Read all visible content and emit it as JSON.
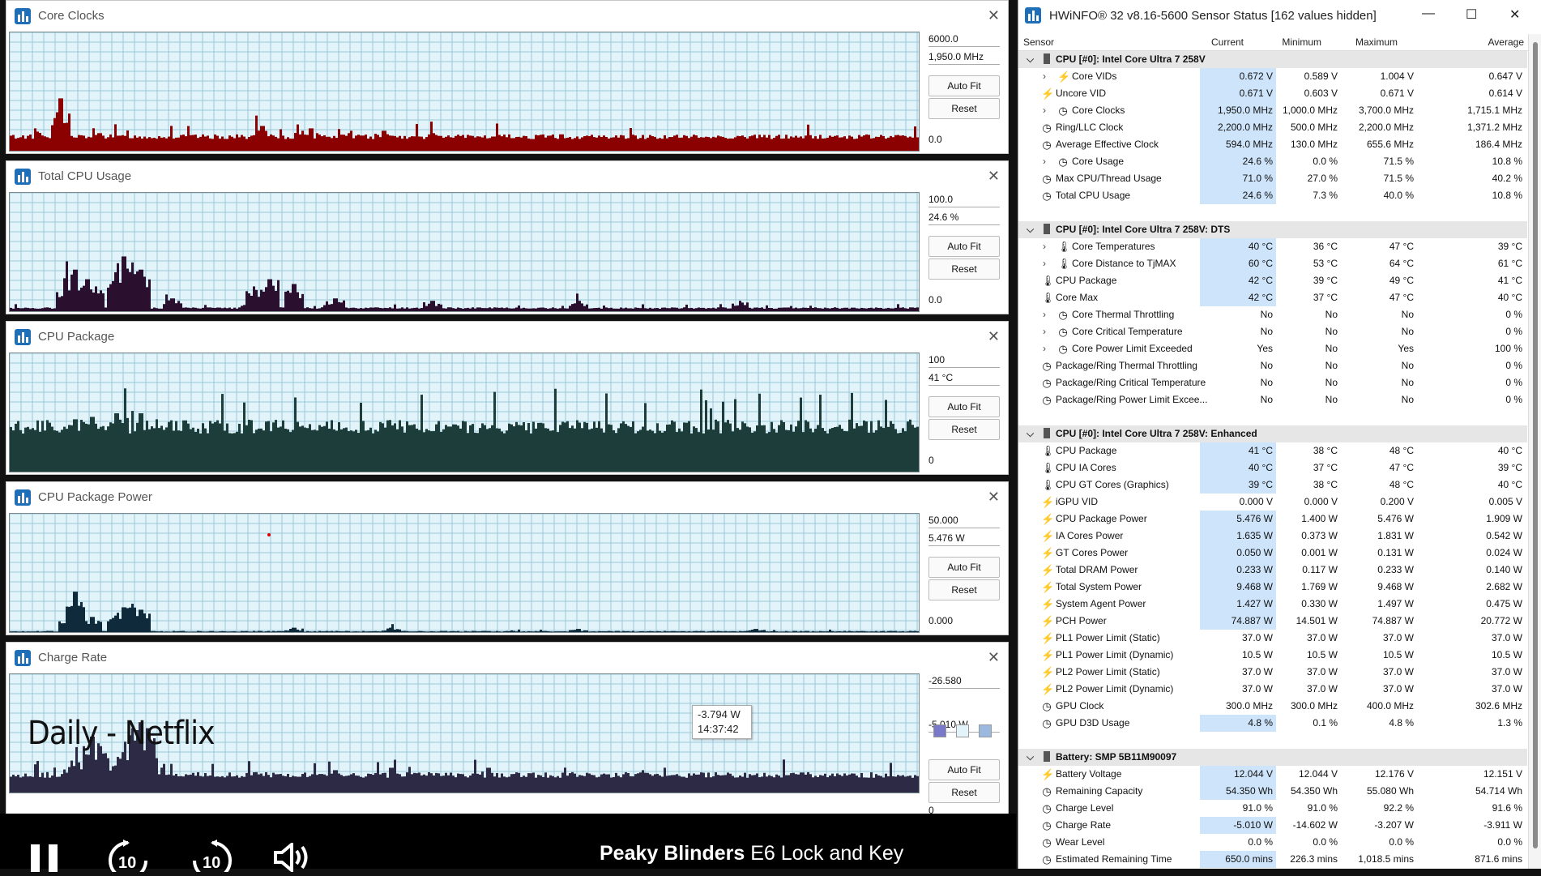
{
  "graphs": [
    {
      "title": "Core Clocks",
      "max": "6000.0",
      "current": "1,950.0 MHz",
      "min": "0.0",
      "autofit": "Auto Fit",
      "reset": "Reset",
      "color": "#8b0000",
      "base": 0.13,
      "spikes": [
        [
          62,
          0.45
        ],
        [
          30,
          0.2
        ],
        [
          110,
          0.16
        ],
        [
          310,
          0.22
        ],
        [
          360,
          0.18
        ],
        [
          370,
          0.2
        ],
        [
          420,
          0.18
        ],
        [
          460,
          0.18
        ],
        [
          520,
          0.16
        ],
        [
          600,
          0.15
        ],
        [
          680,
          0.15
        ]
      ]
    },
    {
      "title": "Total CPU Usage",
      "max": "100.0",
      "current": "24.6 %",
      "min": "0.0",
      "autofit": "Auto Fit",
      "reset": "Reset",
      "color": "#2a0f2e",
      "base": 0.04,
      "spikes": [
        [
          68,
          0.18
        ],
        [
          80,
          0.36
        ],
        [
          95,
          0.28
        ],
        [
          105,
          0.22
        ],
        [
          130,
          0.3
        ],
        [
          140,
          0.47
        ],
        [
          150,
          0.42
        ],
        [
          160,
          0.36
        ],
        [
          200,
          0.12
        ],
        [
          300,
          0.22
        ],
        [
          320,
          0.28
        ],
        [
          350,
          0.24
        ],
        [
          400,
          0.12
        ],
        [
          520,
          0.1
        ],
        [
          700,
          0.1
        ],
        [
          900,
          0.1
        ]
      ]
    },
    {
      "title": "CPU Package",
      "max": "100",
      "current": "41 °C",
      "min": "0",
      "autofit": "Auto Fit",
      "reset": "Reset",
      "color": "#1d3d3a",
      "base": 0.39,
      "spikes": [
        [
          80,
          0.45
        ],
        [
          100,
          0.47
        ],
        [
          130,
          0.5
        ],
        [
          150,
          0.52
        ],
        [
          160,
          0.5
        ],
        [
          180,
          0.45
        ]
      ]
    },
    {
      "title": "CPU Package Power",
      "max": "50.000",
      "current": "5.476 W",
      "min": "0.000",
      "autofit": "Auto Fit",
      "reset": "Reset",
      "color": "#0f2a3a",
      "base": 0.02,
      "spikes": [
        [
          70,
          0.12
        ],
        [
          80,
          0.35
        ],
        [
          90,
          0.12
        ],
        [
          100,
          0.14
        ],
        [
          130,
          0.15
        ],
        [
          140,
          0.22
        ],
        [
          150,
          0.25
        ],
        [
          160,
          0.2
        ],
        [
          350,
          0.05
        ],
        [
          470,
          0.05
        ],
        [
          700,
          0.04
        ],
        [
          920,
          0.04
        ]
      ]
    },
    {
      "title": "Charge Rate",
      "max": "-26.580",
      "current": "-5.010 W",
      "min": "0",
      "autofit": "Auto Fit",
      "reset": "Reset",
      "color": "#2c2a45",
      "base": 0.16,
      "spikes": [
        [
          75,
          0.28
        ],
        [
          90,
          0.4
        ],
        [
          100,
          0.48
        ],
        [
          110,
          0.4
        ],
        [
          120,
          0.3
        ],
        [
          140,
          0.35
        ],
        [
          150,
          0.55
        ],
        [
          160,
          0.6
        ],
        [
          170,
          0.55
        ],
        [
          180,
          0.3
        ],
        [
          400,
          0.2
        ],
        [
          470,
          0.22
        ],
        [
          590,
          0.22
        ],
        [
          780,
          0.2
        ]
      ],
      "overlay": "Daily - Netflix",
      "tooltip_value": "-3.794 W",
      "tooltip_time": "14:37:42"
    }
  ],
  "player": {
    "title_show": "Peaky Blinders",
    "title_ep": "E6  Lock and Key",
    "skip_back": "10",
    "skip_fwd": "10"
  },
  "sensor": {
    "title": "HWiNFO® 32 v8.16-5600 Sensor Status [162 values hidden]",
    "columns": {
      "sensor": "Sensor",
      "current": "Current",
      "minimum": "Minimum",
      "maximum": "Maximum",
      "average": "Average"
    },
    "rows": [
      {
        "t": "group",
        "label": "CPU [#0]: Intel Core Ultra 7 258V"
      },
      {
        "t": "row",
        "icon": "bolt",
        "exp": true,
        "label": "Core VIDs",
        "cur": "0.672 V",
        "min": "0.589 V",
        "max": "1.004 V",
        "avg": "0.647 V",
        "hl": true
      },
      {
        "t": "row",
        "icon": "bolt",
        "label": "Uncore VID",
        "cur": "0.671 V",
        "min": "0.603 V",
        "max": "0.671 V",
        "avg": "0.614 V",
        "hl": true
      },
      {
        "t": "row",
        "icon": "clock",
        "exp": true,
        "label": "Core Clocks",
        "cur": "1,950.0 MHz",
        "min": "1,000.0 MHz",
        "max": "3,700.0 MHz",
        "avg": "1,715.1 MHz",
        "hl": true
      },
      {
        "t": "row",
        "icon": "clock",
        "label": "Ring/LLC Clock",
        "cur": "2,200.0 MHz",
        "min": "500.0 MHz",
        "max": "2,200.0 MHz",
        "avg": "1,371.2 MHz",
        "hl": true
      },
      {
        "t": "row",
        "icon": "clock",
        "label": "Average Effective Clock",
        "cur": "594.0 MHz",
        "min": "130.0 MHz",
        "max": "655.6 MHz",
        "avg": "186.4 MHz",
        "hl": true
      },
      {
        "t": "row",
        "icon": "clock",
        "exp": true,
        "label": "Core Usage",
        "cur": "24.6 %",
        "min": "0.0 %",
        "max": "71.5 %",
        "avg": "10.8 %",
        "hl": true
      },
      {
        "t": "row",
        "icon": "clock",
        "label": "Max CPU/Thread Usage",
        "cur": "71.0 %",
        "min": "27.0 %",
        "max": "71.5 %",
        "avg": "40.2 %",
        "hl": true
      },
      {
        "t": "row",
        "icon": "clock",
        "label": "Total CPU Usage",
        "cur": "24.6 %",
        "min": "7.3 %",
        "max": "40.0 %",
        "avg": "10.8 %",
        "hl": true
      },
      {
        "t": "blank"
      },
      {
        "t": "group",
        "label": "CPU [#0]: Intel Core Ultra 7 258V: DTS"
      },
      {
        "t": "row",
        "icon": "therm",
        "exp": true,
        "label": "Core Temperatures",
        "cur": "40 °C",
        "min": "36 °C",
        "max": "47 °C",
        "avg": "39 °C",
        "hl": true
      },
      {
        "t": "row",
        "icon": "therm",
        "exp": true,
        "label": "Core Distance to TjMAX",
        "cur": "60 °C",
        "min": "53 °C",
        "max": "64 °C",
        "avg": "61 °C",
        "hl": true
      },
      {
        "t": "row",
        "icon": "therm",
        "label": "CPU Package",
        "cur": "42 °C",
        "min": "39 °C",
        "max": "49 °C",
        "avg": "41 °C",
        "hl": true
      },
      {
        "t": "row",
        "icon": "therm",
        "label": "Core Max",
        "cur": "42 °C",
        "min": "37 °C",
        "max": "47 °C",
        "avg": "40 °C",
        "hl": true
      },
      {
        "t": "row",
        "icon": "clock",
        "exp": true,
        "label": "Core Thermal Throttling",
        "cur": "No",
        "min": "No",
        "max": "No",
        "avg": "0 %"
      },
      {
        "t": "row",
        "icon": "clock",
        "exp": true,
        "label": "Core Critical Temperature",
        "cur": "No",
        "min": "No",
        "max": "No",
        "avg": "0 %"
      },
      {
        "t": "row",
        "icon": "clock",
        "exp": true,
        "label": "Core Power Limit Exceeded",
        "cur": "Yes",
        "min": "No",
        "max": "Yes",
        "avg": "100 %"
      },
      {
        "t": "row",
        "icon": "clock",
        "label": "Package/Ring Thermal Throttling",
        "cur": "No",
        "min": "No",
        "max": "No",
        "avg": "0 %"
      },
      {
        "t": "row",
        "icon": "clock",
        "label": "Package/Ring Critical Temperature",
        "cur": "No",
        "min": "No",
        "max": "No",
        "avg": "0 %"
      },
      {
        "t": "row",
        "icon": "clock",
        "label": "Package/Ring Power Limit Excee...",
        "cur": "No",
        "min": "No",
        "max": "No",
        "avg": "0 %"
      },
      {
        "t": "blank"
      },
      {
        "t": "group",
        "label": "CPU [#0]: Intel Core Ultra 7 258V: Enhanced"
      },
      {
        "t": "row",
        "icon": "therm",
        "label": "CPU Package",
        "cur": "41 °C",
        "min": "38 °C",
        "max": "48 °C",
        "avg": "40 °C",
        "hl": true
      },
      {
        "t": "row",
        "icon": "therm",
        "label": "CPU IA Cores",
        "cur": "40 °C",
        "min": "37 °C",
        "max": "47 °C",
        "avg": "39 °C",
        "hl": true
      },
      {
        "t": "row",
        "icon": "therm",
        "label": "CPU GT Cores (Graphics)",
        "cur": "39 °C",
        "min": "38 °C",
        "max": "48 °C",
        "avg": "40 °C",
        "hl": true
      },
      {
        "t": "row",
        "icon": "bolt",
        "label": "iGPU VID",
        "cur": "0.000 V",
        "min": "0.000 V",
        "max": "0.200 V",
        "avg": "0.005 V"
      },
      {
        "t": "row",
        "icon": "bolt",
        "label": "CPU Package Power",
        "cur": "5.476 W",
        "min": "1.400 W",
        "max": "5.476 W",
        "avg": "1.909 W",
        "hl": true
      },
      {
        "t": "row",
        "icon": "bolt",
        "label": "IA Cores Power",
        "cur": "1.635 W",
        "min": "0.373 W",
        "max": "1.831 W",
        "avg": "0.542 W",
        "hl": true
      },
      {
        "t": "row",
        "icon": "bolt",
        "label": "GT Cores Power",
        "cur": "0.050 W",
        "min": "0.001 W",
        "max": "0.131 W",
        "avg": "0.024 W",
        "hl": true
      },
      {
        "t": "row",
        "icon": "bolt",
        "label": "Total DRAM Power",
        "cur": "0.233 W",
        "min": "0.117 W",
        "max": "0.233 W",
        "avg": "0.140 W",
        "hl": true
      },
      {
        "t": "row",
        "icon": "bolt",
        "label": "Total System Power",
        "cur": "9.468 W",
        "min": "1.769 W",
        "max": "9.468 W",
        "avg": "2.682 W",
        "hl": true
      },
      {
        "t": "row",
        "icon": "bolt",
        "label": "System Agent Power",
        "cur": "1.427 W",
        "min": "0.330 W",
        "max": "1.497 W",
        "avg": "0.475 W",
        "hl": true
      },
      {
        "t": "row",
        "icon": "bolt",
        "label": "PCH Power",
        "cur": "74.887 W",
        "min": "14.501 W",
        "max": "74.887 W",
        "avg": "20.772 W",
        "hl": true
      },
      {
        "t": "row",
        "icon": "bolt",
        "label": "PL1 Power Limit (Static)",
        "cur": "37.0 W",
        "min": "37.0 W",
        "max": "37.0 W",
        "avg": "37.0 W"
      },
      {
        "t": "row",
        "icon": "bolt",
        "label": "PL1 Power Limit (Dynamic)",
        "cur": "10.5 W",
        "min": "10.5 W",
        "max": "10.5 W",
        "avg": "10.5 W"
      },
      {
        "t": "row",
        "icon": "bolt",
        "label": "PL2 Power Limit (Static)",
        "cur": "37.0 W",
        "min": "37.0 W",
        "max": "37.0 W",
        "avg": "37.0 W"
      },
      {
        "t": "row",
        "icon": "bolt",
        "label": "PL2 Power Limit (Dynamic)",
        "cur": "37.0 W",
        "min": "37.0 W",
        "max": "37.0 W",
        "avg": "37.0 W"
      },
      {
        "t": "row",
        "icon": "clock",
        "label": "GPU Clock",
        "cur": "300.0 MHz",
        "min": "300.0 MHz",
        "max": "400.0 MHz",
        "avg": "302.6 MHz"
      },
      {
        "t": "row",
        "icon": "clock",
        "label": "GPU D3D Usage",
        "cur": "4.8 %",
        "min": "0.1 %",
        "max": "4.8 %",
        "avg": "1.3 %",
        "hl": true
      },
      {
        "t": "blank"
      },
      {
        "t": "group",
        "label": "Battery: SMP 5B11M90097"
      },
      {
        "t": "row",
        "icon": "bolt",
        "label": "Battery Voltage",
        "cur": "12.044 V",
        "min": "12.044 V",
        "max": "12.176 V",
        "avg": "12.151 V",
        "hl": true
      },
      {
        "t": "row",
        "icon": "clock",
        "label": "Remaining Capacity",
        "cur": "54.350 Wh",
        "min": "54.350 Wh",
        "max": "55.080 Wh",
        "avg": "54.714 Wh",
        "hl": true
      },
      {
        "t": "row",
        "icon": "clock",
        "label": "Charge Level",
        "cur": "91.0 %",
        "min": "91.0 %",
        "max": "92.2 %",
        "avg": "91.6 %"
      },
      {
        "t": "row",
        "icon": "clock",
        "label": "Charge Rate",
        "cur": "-5.010 W",
        "min": "-14.602 W",
        "max": "-3.207 W",
        "avg": "-3.911 W",
        "hl": true
      },
      {
        "t": "row",
        "icon": "clock",
        "label": "Wear Level",
        "cur": "0.0 %",
        "min": "0.0 %",
        "max": "0.0 %",
        "avg": "0.0 %"
      },
      {
        "t": "row",
        "icon": "clock",
        "label": "Estimated Remaining Time",
        "cur": "650.0 mins",
        "min": "226.3 mins",
        "max": "1,018.5 mins",
        "avg": "871.6 mins",
        "hl": true
      }
    ]
  }
}
